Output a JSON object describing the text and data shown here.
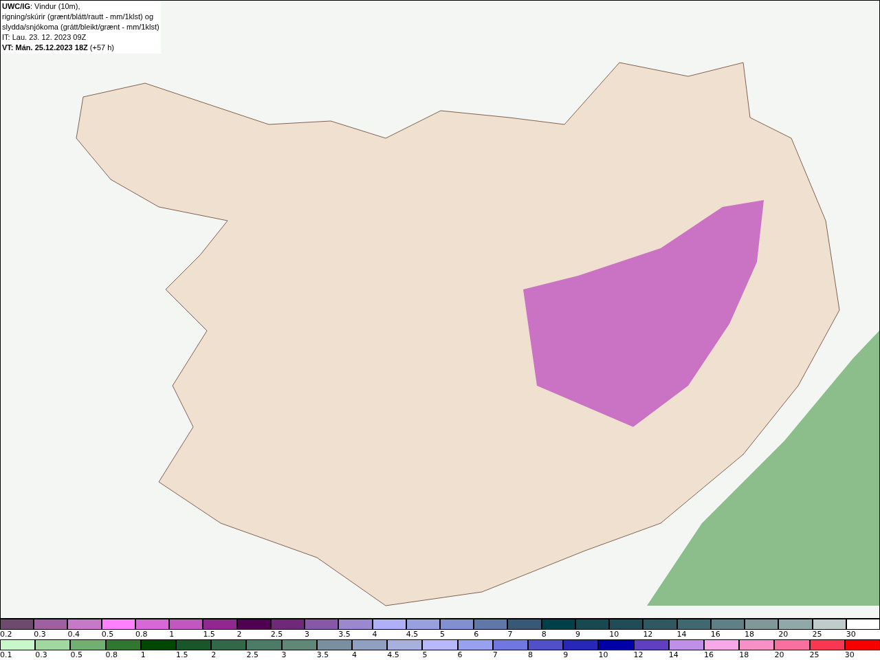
{
  "info_box": {
    "lines": [
      "**UWC/IG**: Vindur (10m),",
      "rigning/skúrir (grænt/blátt/rautt - mm/1klst) og",
      "slydda/snjókoma (grátt/bleikt/grænt - mm/1klst)",
      "IT: Lau. 23. 12. 2023 09Z",
      "**VT: Mán. 25.12.2023 18Z** (+57 h)"
    ]
  },
  "legends": [
    {
      "swatches": [
        {
          "label": "0.2",
          "color": "#6e4a6e"
        },
        {
          "label": "0.3",
          "color": "#a060a0"
        },
        {
          "label": "0.4",
          "color": "#c878c8"
        },
        {
          "label": "0.5",
          "color": "#ff80ff"
        },
        {
          "label": "0.8",
          "color": "#d868d8"
        },
        {
          "label": "1",
          "color": "#c058c0"
        },
        {
          "label": "1.5",
          "color": "#902890"
        },
        {
          "label": "2",
          "color": "#500050"
        },
        {
          "label": "2.5",
          "color": "#702878"
        },
        {
          "label": "3",
          "color": "#8858a8"
        },
        {
          "label": "3.5",
          "color": "#9c88d0"
        },
        {
          "label": "4",
          "color": "#b0b0f8"
        },
        {
          "label": "4.5",
          "color": "#98a0e0"
        },
        {
          "label": "5",
          "color": "#8090d0"
        },
        {
          "label": "6",
          "color": "#6078a8"
        },
        {
          "label": "7",
          "color": "#385878"
        },
        {
          "label": "8",
          "color": "#004048"
        },
        {
          "label": "9",
          "color": "#184850"
        },
        {
          "label": "10",
          "color": "#204c58"
        },
        {
          "label": "12",
          "color": "#305860"
        },
        {
          "label": "14",
          "color": "#406870"
        },
        {
          "label": "16",
          "color": "#608088"
        },
        {
          "label": "18",
          "color": "#809898"
        },
        {
          "label": "20",
          "color": "#90a8a8"
        },
        {
          "label": "25",
          "color": "#c0cccc"
        },
        {
          "label": "30",
          "color": "#ffffff"
        }
      ]
    },
    {
      "swatches": [
        {
          "label": "0.1",
          "color": "#c8f8c8"
        },
        {
          "label": "0.3",
          "color": "#a0d8a0"
        },
        {
          "label": "0.5",
          "color": "#70b070"
        },
        {
          "label": "0.8",
          "color": "#307830"
        },
        {
          "label": "1",
          "color": "#004800"
        },
        {
          "label": "1.5",
          "color": "#185828"
        },
        {
          "label": "2",
          "color": "#306848"
        },
        {
          "label": "2.5",
          "color": "#4c7c68"
        },
        {
          "label": "3",
          "color": "#608878"
        },
        {
          "label": "3.5",
          "color": "#7890a0"
        },
        {
          "label": "4",
          "color": "#90a0c0"
        },
        {
          "label": "4.5",
          "color": "#a8b0e0"
        },
        {
          "label": "5",
          "color": "#b8b8ff"
        },
        {
          "label": "6",
          "color": "#98a0f0"
        },
        {
          "label": "7",
          "color": "#7078e0"
        },
        {
          "label": "8",
          "color": "#5050c8"
        },
        {
          "label": "9",
          "color": "#2828b8"
        },
        {
          "label": "10",
          "color": "#0000a8"
        },
        {
          "label": "12",
          "color": "#6040c0"
        },
        {
          "label": "14",
          "color": "#c090e8"
        },
        {
          "label": "16",
          "color": "#f8a8e8"
        },
        {
          "label": "18",
          "color": "#f890c8"
        },
        {
          "label": "20",
          "color": "#f870a0"
        },
        {
          "label": "25",
          "color": "#f83850"
        },
        {
          "label": "30",
          "color": "#f80000"
        }
      ]
    }
  ]
}
